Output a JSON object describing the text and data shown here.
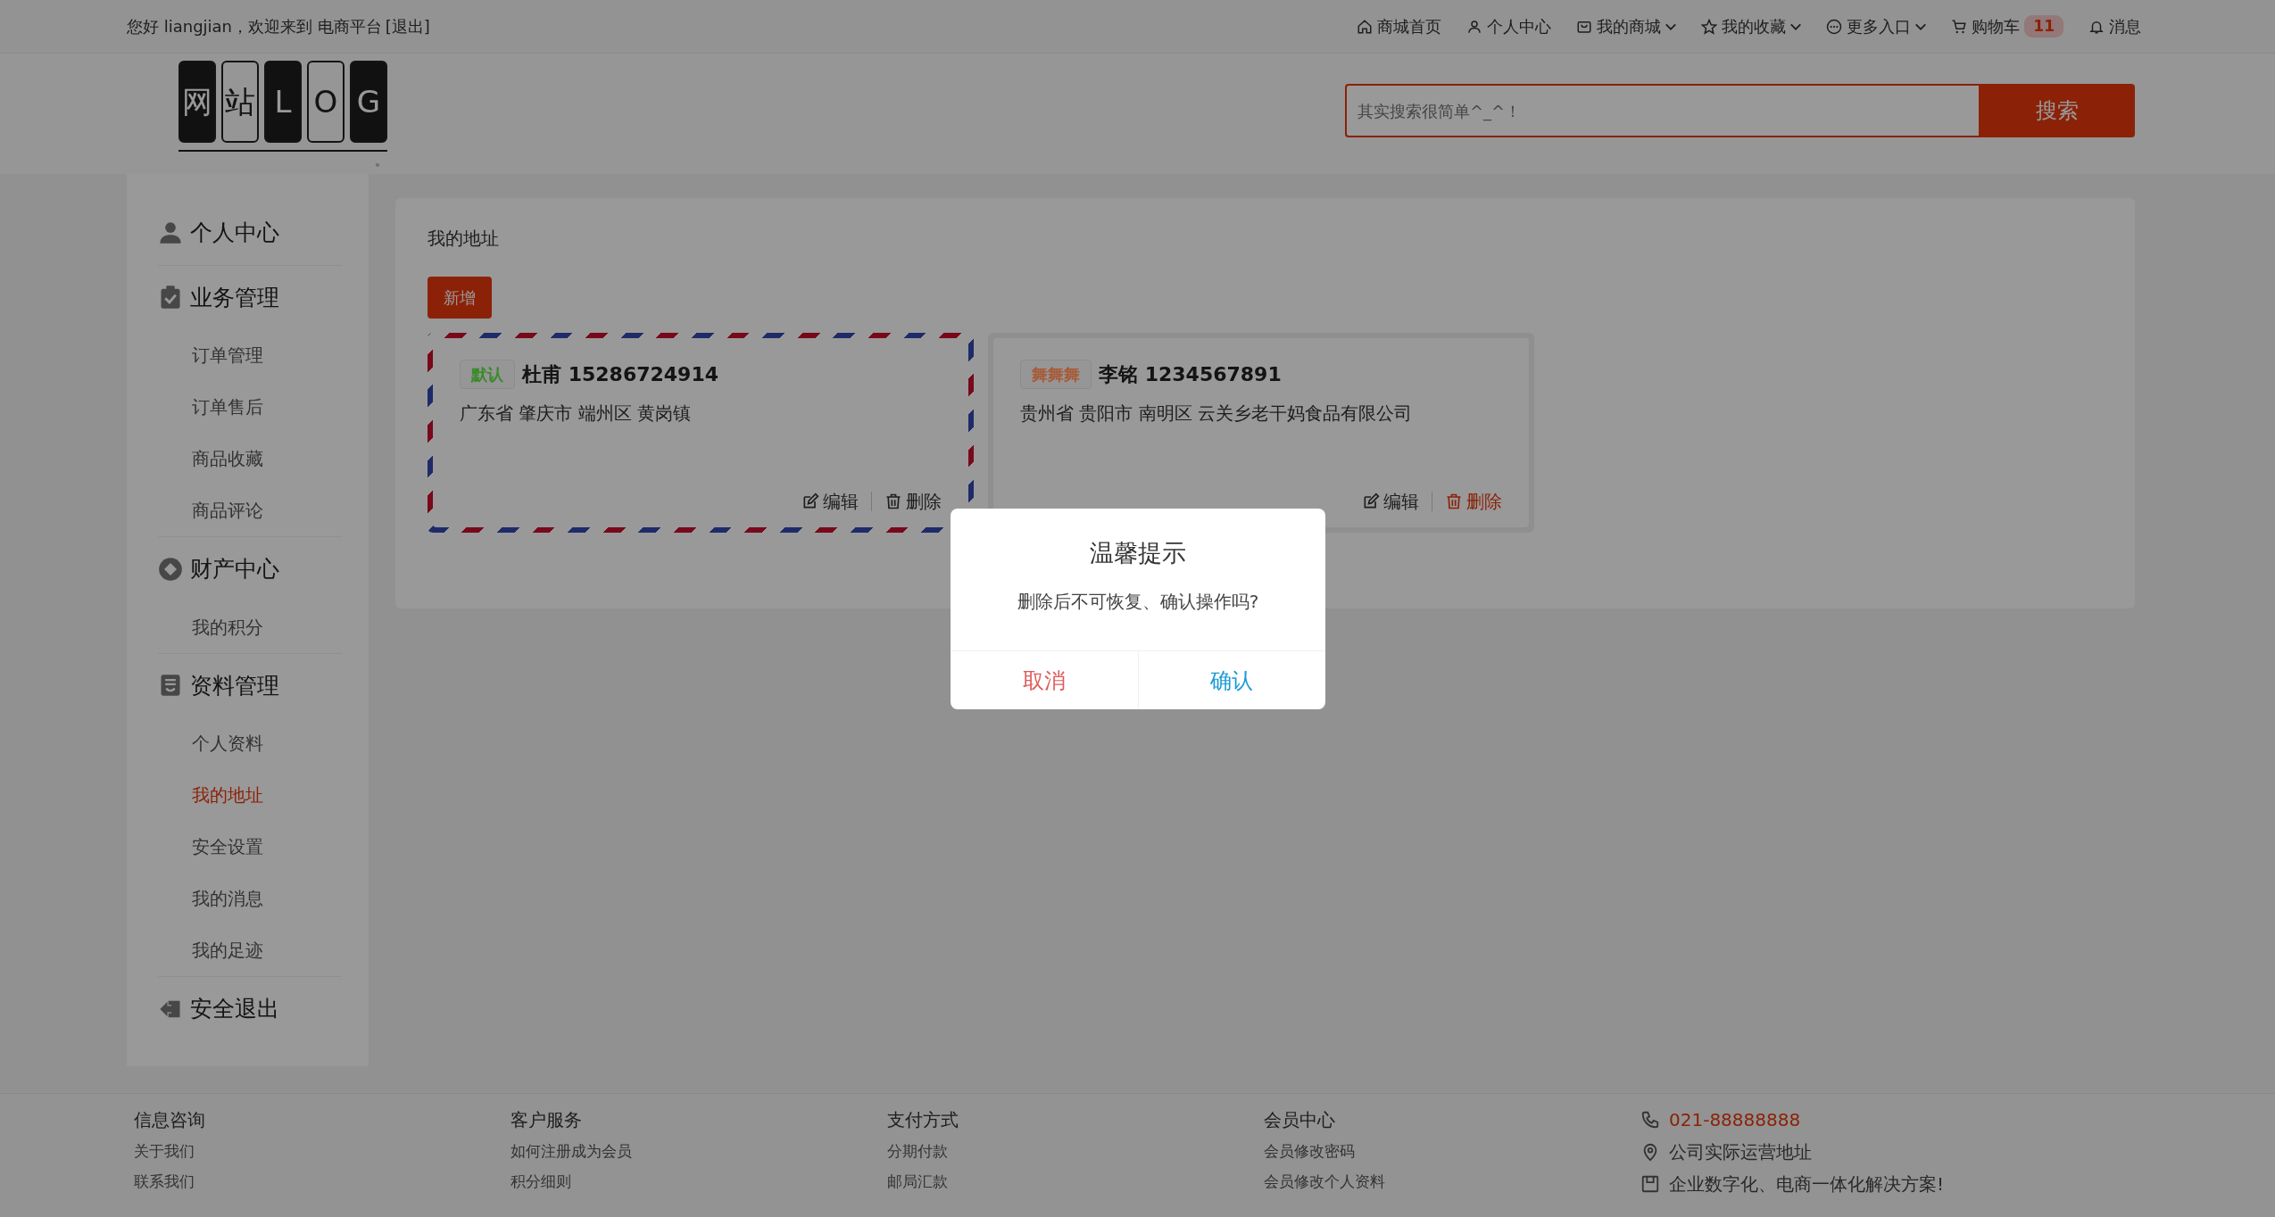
{
  "top_bar": {
    "greeting": "您好 liangjian，欢迎来到 电商平台",
    "logout": "[退出]",
    "nav": [
      {
        "label": "商城首页",
        "dropdown": false
      },
      {
        "label": "个人中心",
        "dropdown": false
      },
      {
        "label": "我的商城",
        "dropdown": true
      },
      {
        "label": "我的收藏",
        "dropdown": true
      },
      {
        "label": "更多入口",
        "dropdown": true
      },
      {
        "label": "购物车",
        "dropdown": false,
        "badge": "11"
      },
      {
        "label": "消息",
        "dropdown": false
      }
    ]
  },
  "header": {
    "logo": {
      "chars": [
        "网",
        "站",
        "L",
        "O",
        "G"
      ],
      "mark": "。"
    },
    "search": {
      "placeholder": "其实搜索很简单^_^！",
      "button": "搜索"
    }
  },
  "sidebar": {
    "groups": [
      {
        "title": "个人中心"
      },
      {
        "title": "业务管理",
        "items": [
          {
            "label": "订单管理",
            "selected": false
          },
          {
            "label": "订单售后",
            "selected": false
          },
          {
            "label": "商品收藏",
            "selected": false
          },
          {
            "label": "商品评论",
            "selected": false
          }
        ]
      },
      {
        "title": "财产中心",
        "items": [
          {
            "label": "我的积分",
            "selected": false
          }
        ]
      },
      {
        "title": "资料管理",
        "items": [
          {
            "label": "个人资料",
            "selected": false
          },
          {
            "label": "我的地址",
            "selected": true
          },
          {
            "label": "安全设置",
            "selected": false
          },
          {
            "label": "我的消息",
            "selected": false
          },
          {
            "label": "我的足迹",
            "selected": false
          }
        ]
      },
      {
        "title": "安全退出"
      }
    ]
  },
  "main": {
    "title": "我的地址",
    "add_button": "新增",
    "addresses": [
      {
        "tag": {
          "text": "默认",
          "color": "#3a8a2a"
        },
        "name_phone": "杜甫 15286724914",
        "address": "广东省 肇庆市 端州区 黄岗镇",
        "is_default": true,
        "actions": [
          {
            "kind": "edit",
            "label": "编辑",
            "highlighted": false
          },
          {
            "kind": "delete",
            "label": "删除",
            "highlighted": false
          }
        ]
      },
      {
        "tag": {
          "text": "舞舞舞",
          "color": "#a85a35"
        },
        "name_phone": "李铭 1234567891",
        "address": "贵州省 贵阳市 南明区 云关乡老干妈食品有限公司",
        "is_default": false,
        "actions": [
          {
            "kind": "edit",
            "label": "编辑",
            "highlighted": false
          },
          {
            "kind": "delete",
            "label": "删除",
            "highlighted": true
          }
        ]
      }
    ]
  },
  "dialog": {
    "title": "温馨提示",
    "message": "删除后不可恢复、确认操作吗?",
    "cancel": "取消",
    "confirm": "确认"
  },
  "footer": {
    "columns": [
      {
        "title": "信息咨询",
        "links": [
          "关于我们",
          "联系我们"
        ]
      },
      {
        "title": "客户服务",
        "links": [
          "如何注册成为会员",
          "积分细则"
        ]
      },
      {
        "title": "支付方式",
        "links": [
          "分期付款",
          "邮局汇款"
        ]
      },
      {
        "title": "会员中心",
        "links": [
          "会员修改密码",
          "会员修改个人资料"
        ]
      }
    ],
    "contact": [
      {
        "text": "021-88888888",
        "accent": true
      },
      {
        "text": "公司实际运营地址",
        "accent": false
      },
      {
        "text": "企业数字化、电商一体化解决方案!",
        "accent": false
      }
    ]
  }
}
